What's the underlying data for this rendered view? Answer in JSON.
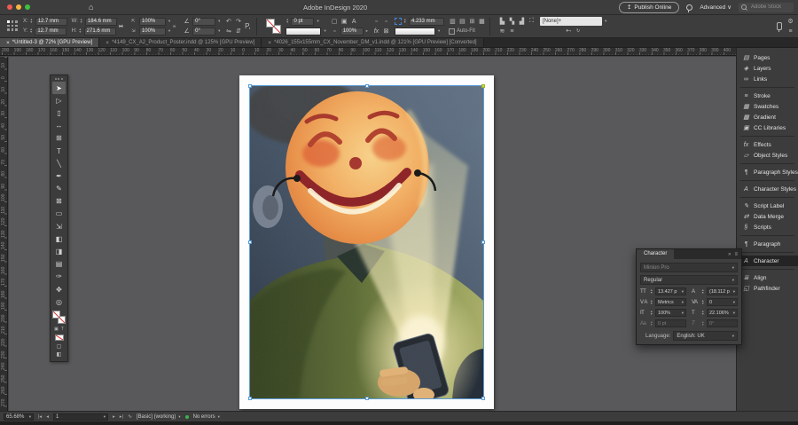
{
  "window": {
    "title": "Adobe InDesign 2020"
  },
  "titlebar": {
    "publish_button": "Publish Online",
    "advanced_menu": "Advanced",
    "advanced_chevron": "∨",
    "search_placeholder": "Adobe Stock"
  },
  "control_panel": {
    "x_label": "X:",
    "x_value": "12.7 mm",
    "y_label": "Y:",
    "y_value": "12.7 mm",
    "w_label": "W:",
    "w_value": "184.6 mm",
    "h_label": "H:",
    "h_value": "271.6 mm",
    "scale_x_value": "100%",
    "scale_y_value": "100%",
    "rotation_value": "0°",
    "shear_value": "0°",
    "stroke_weight_value": "0 pt",
    "opacity_value": "100%",
    "corner_radius_value": "4.233 mm",
    "auto_fit_label": "Auto-Fit",
    "object_style_value": "[None]+",
    "paragraph_icon": "P,"
  },
  "tabs": [
    {
      "label": "*Untitled-3 @ 72% [GPU Preview]",
      "active": true
    },
    {
      "label": "*4149_CX_A2_Product_Poster.indd @ 125% [GPU Preview]",
      "active": false
    },
    {
      "label": "*4026_155x155mm_CX_November_DM_v1.indd @ 121% [GPU Preview] [Converted]",
      "active": false
    }
  ],
  "ruler": {
    "h_labels": [
      "200",
      "190",
      "180",
      "170",
      "160",
      "150",
      "140",
      "130",
      "120",
      "110",
      "100",
      "90",
      "80",
      "70",
      "60",
      "50",
      "40",
      "30",
      "20",
      "10",
      "0",
      "10",
      "20",
      "30",
      "40",
      "50",
      "60",
      "70",
      "80",
      "90",
      "100",
      "110",
      "120",
      "130",
      "140",
      "150",
      "160",
      "170",
      "180",
      "190",
      "200",
      "210",
      "220",
      "230",
      "240",
      "250",
      "260",
      "270",
      "280",
      "290",
      "300",
      "310",
      "320",
      "330",
      "340",
      "350",
      "360",
      "370",
      "380",
      "390",
      "400"
    ],
    "v_labels": [
      "10",
      "0",
      "10",
      "20",
      "30",
      "40",
      "50",
      "60",
      "70",
      "80",
      "90",
      "100",
      "110",
      "120",
      "130",
      "140",
      "150",
      "160",
      "170",
      "180",
      "190",
      "200",
      "210",
      "220",
      "230",
      "240",
      "250",
      "260",
      "270"
    ]
  },
  "tools": [
    {
      "glyph": "➤",
      "name": "selection-tool",
      "active": true
    },
    {
      "glyph": "▷",
      "name": "direct-selection-tool"
    },
    {
      "glyph": "▯",
      "name": "page-tool"
    },
    {
      "glyph": "↔",
      "name": "gap-tool"
    },
    {
      "glyph": "⊞",
      "name": "content-collector-tool"
    },
    {
      "glyph": "T",
      "name": "type-tool"
    },
    {
      "glyph": "╲",
      "name": "line-tool"
    },
    {
      "glyph": "✒",
      "name": "pen-tool"
    },
    {
      "glyph": "✎",
      "name": "pencil-tool"
    },
    {
      "glyph": "⊠",
      "name": "rectangle-frame-tool"
    },
    {
      "glyph": "▭",
      "name": "rectangle-tool"
    },
    {
      "glyph": "⇲",
      "name": "free-transform-tool"
    },
    {
      "glyph": "◧",
      "name": "gradient-swatch-tool"
    },
    {
      "glyph": "◨",
      "name": "gradient-feather-tool"
    },
    {
      "glyph": "▤",
      "name": "note-tool"
    },
    {
      "glyph": "✑",
      "name": "color-theme-tool"
    },
    {
      "glyph": "✥",
      "name": "hand-tool"
    },
    {
      "glyph": "◎",
      "name": "zoom-tool"
    }
  ],
  "dock_panels": [
    {
      "icon": "▤",
      "label": "Pages"
    },
    {
      "icon": "◈",
      "label": "Layers"
    },
    {
      "icon": "∞",
      "label": "Links"
    },
    {
      "divider": true
    },
    {
      "icon": "≡",
      "label": "Stroke"
    },
    {
      "icon": "▦",
      "label": "Swatches"
    },
    {
      "icon": "▩",
      "label": "Gradient"
    },
    {
      "icon": "▣",
      "label": "CC Libraries"
    },
    {
      "divider": true
    },
    {
      "icon": "fx",
      "label": "Effects"
    },
    {
      "icon": "▱",
      "label": "Object Styles"
    },
    {
      "divider": true
    },
    {
      "icon": "¶",
      "label": "Paragraph Styles"
    },
    {
      "divider": true
    },
    {
      "icon": "A",
      "label": "Character Styles"
    },
    {
      "divider": true
    },
    {
      "icon": "✎",
      "label": "Script Label"
    },
    {
      "icon": "⇄",
      "label": "Data Merge"
    },
    {
      "icon": "§",
      "label": "Scripts"
    },
    {
      "divider": true
    },
    {
      "icon": "¶",
      "label": "Paragraph"
    },
    {
      "divider": true
    },
    {
      "icon": "A",
      "label": "Character",
      "active": true
    },
    {
      "divider": true
    },
    {
      "icon": "≣",
      "label": "Align"
    },
    {
      "icon": "◱",
      "label": "Pathfinder"
    }
  ],
  "character_panel": {
    "tab_title": "Character",
    "font_family": "Minion Pro",
    "font_style": "Regular",
    "size_icon": "TT",
    "size_value": "13.427 p",
    "leading_icon": "A",
    "leading_value": "(18.112 p",
    "kerning_icon": "V A",
    "kerning_value": "Metrics",
    "tracking_icon": "VA",
    "tracking_value": "0",
    "vscale_icon": "IT",
    "vscale_value": "100%",
    "hscale_icon": "T",
    "hscale_value": "22.106%",
    "baseline_icon": "Aa",
    "baseline_value": "0 pt",
    "skew_icon": "T",
    "skew_value": "0°",
    "language_label": "Language:",
    "language_value": "English: UK"
  },
  "status_bar": {
    "zoom_value": "65.68%",
    "page_value": "1",
    "preflight_profile": "[Basic] (working)",
    "preflight_status": "No errors"
  },
  "artwork": {
    "description": "Illustration of a person in a green jumper whose head is a large orange smiley-face mask, face lit by the glow of a smartphone held in both hands",
    "colors": {
      "background": "#435264",
      "face": "#f3b063",
      "smile": "#8c2125",
      "sweater": "#5d6c35",
      "light_beam": "#f2e9bd",
      "phone": "#23282f",
      "selection": "#5b9bd5"
    }
  }
}
